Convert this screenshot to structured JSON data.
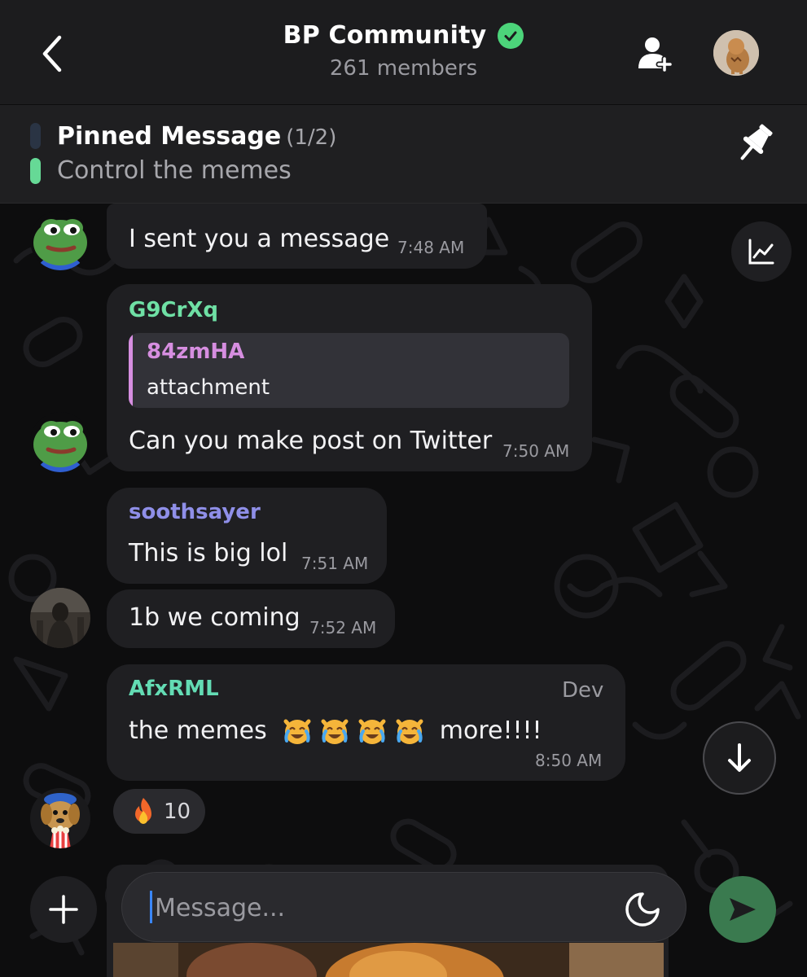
{
  "header": {
    "title": "BP Community",
    "subtitle": "261 members",
    "verified_icon": "check-circle-icon",
    "back_icon": "chevron-left-icon",
    "add_member_icon": "add-user-icon"
  },
  "pinned": {
    "label": "Pinned Message",
    "count": "(1/2)",
    "text": "Control the memes",
    "icon": "pin-icon"
  },
  "messages": [
    {
      "text": "I sent you a message",
      "time": "7:48 AM"
    },
    {
      "sender": "G9CrXq",
      "reply_sender": "84zmHA",
      "reply_text": "attachment",
      "text": "Can you make post on Twitter",
      "time": "7:50 AM"
    },
    {
      "sender": "soothsayer",
      "text": "This is big lol",
      "time": "7:51 AM"
    },
    {
      "text": "1b we coming",
      "time": "7:52 AM"
    },
    {
      "sender": "AfxRML",
      "badge": "Dev",
      "text_before": "the memes",
      "text_after": "more!!!!",
      "emoji": [
        "😹",
        "😹",
        "😹",
        "😹"
      ],
      "time": "8:50 AM"
    }
  ],
  "reaction": {
    "emoji": "🔥",
    "count": "10"
  },
  "composer": {
    "placeholder": "Message...",
    "add_icon": "plus-icon",
    "sticker_icon": "sticker-icon",
    "send_icon": "send-icon"
  },
  "floating": {
    "chart_icon": "chart-icon",
    "scroll_down_icon": "arrow-down-icon"
  },
  "colors": {
    "header_bg": "#1c1c1e",
    "bubble_bg": "#1f1f22",
    "accent_green": "#4cd47a",
    "sender_green": "#6fe0a5",
    "sender_pink": "#d68ee0",
    "sender_purple": "#8f8fe8",
    "sender_teal": "#63dcb4",
    "send_button": "#3a7a4f"
  }
}
